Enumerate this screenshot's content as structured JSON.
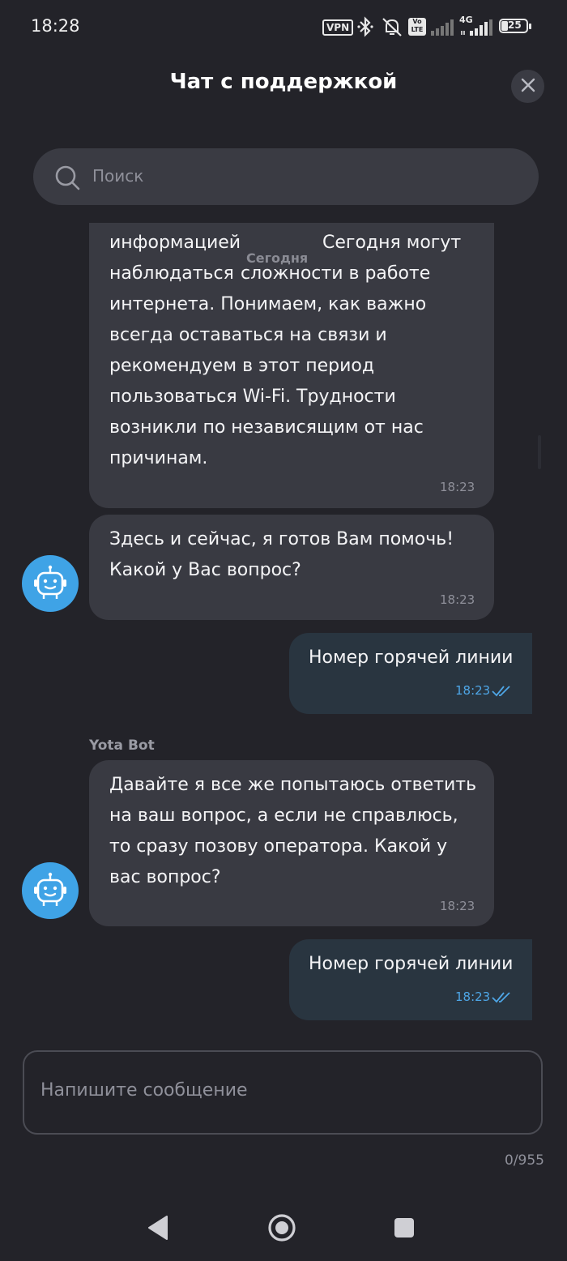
{
  "status_bar": {
    "time": "18:28",
    "vpn": "VPN",
    "volte": "Vo LTE",
    "network": "4G",
    "battery": "25"
  },
  "header": {
    "title": "Чат с поддержкой"
  },
  "search": {
    "placeholder": "Поиск"
  },
  "date_separator": "Сегодня",
  "messages": [
    {
      "from": "bot",
      "text_visible": "информацией\nнаблюдаться\nинтернета. Понимаем, как важно\nвсегда оставаться на связи и\nрекомендуем в этот период\nпользоваться Wi-Fi. Трудности\nвозникли по независящим от нас\nпричинам.",
      "text_line1_right": "Сегодня могут",
      "text_line2_right": "сложности в работе",
      "time": "18:23"
    },
    {
      "from": "bot",
      "text": "Здесь и сейчас, я готов Вам помочь!\nКакой у Вас вопрос?",
      "time": "18:23"
    },
    {
      "from": "user",
      "text": "Номер горячей линии",
      "time": "18:23"
    },
    {
      "from": "bot",
      "sender": "Yota Bot",
      "text": "Давайте я все же попытаюсь ответить\nна ваш вопрос, а если не справлюсь,\nто сразу позову оператора. Какой у\nвас вопрос?",
      "time": "18:23"
    },
    {
      "from": "user",
      "text": "Номер горячей линии",
      "time": "18:23"
    }
  ],
  "composer": {
    "placeholder": "Напишите сообщение",
    "counter": "0/955"
  },
  "colors": {
    "background": "#232329",
    "bubble_bot": "#393a42",
    "bubble_user": "#293540",
    "accent": "#3fa3e6"
  }
}
